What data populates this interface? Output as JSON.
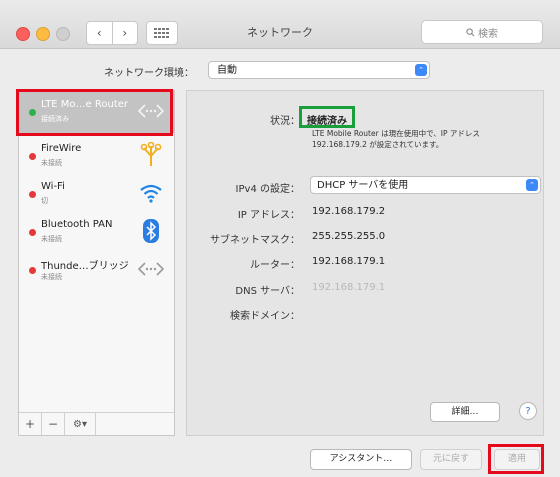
{
  "window": {
    "title": "ネットワーク",
    "search_placeholder": "検索",
    "nav_back": "‹",
    "nav_forward": "›"
  },
  "location": {
    "label": "ネットワーク環境：",
    "value": "自動"
  },
  "services": [
    {
      "name": "LTE Mo…e Router",
      "status": "接続済み",
      "dot_color": "#2bb24c",
      "icon": "ethernet-arrows-icon",
      "selected": true
    },
    {
      "name": "FireWire",
      "status": "未接続",
      "dot_color": "#e5383b",
      "icon": "firewire-icon"
    },
    {
      "name": "Wi-Fi",
      "status": "切",
      "dot_color": "#e5383b",
      "icon": "wifi-icon"
    },
    {
      "name": "Bluetooth PAN",
      "status": "未接続",
      "dot_color": "#e5383b",
      "icon": "bluetooth-icon"
    },
    {
      "name": "Thunde…ブリッジ",
      "status": "未接続",
      "dot_color": "#e5383b",
      "icon": "ethernet-arrows-icon"
    }
  ],
  "sidebar_tools": {
    "add": "+",
    "remove": "−",
    "gear": "⚙▾"
  },
  "detail": {
    "status_label": "状況：",
    "status_value": "接続済み",
    "status_description": "LTE Mobile Router は現在使用中で、IP アドレス 192.168.179.2 が設定されています。",
    "ipv4_label": "IPv4 の設定：",
    "ipv4_value": "DHCP サーバを使用",
    "ip_label": "IP アドレス：",
    "ip_value": "192.168.179.2",
    "subnet_label": "サブネットマスク：",
    "subnet_value": "255.255.255.0",
    "router_label": "ルーター：",
    "router_value": "192.168.179.1",
    "dns_label": "DNS サーバ：",
    "dns_value": "192.168.179.1",
    "search_domain_label": "検索ドメイン：",
    "advanced_button": "詳細…",
    "help_button": "?"
  },
  "footer": {
    "assistant_button": "アシスタント…",
    "revert_button": "元に戻す",
    "apply_button": "適用"
  },
  "colors": {
    "highlight_red": "#e4091b",
    "highlight_green": "#1aa03a",
    "accent_blue": "#3c89f7"
  }
}
